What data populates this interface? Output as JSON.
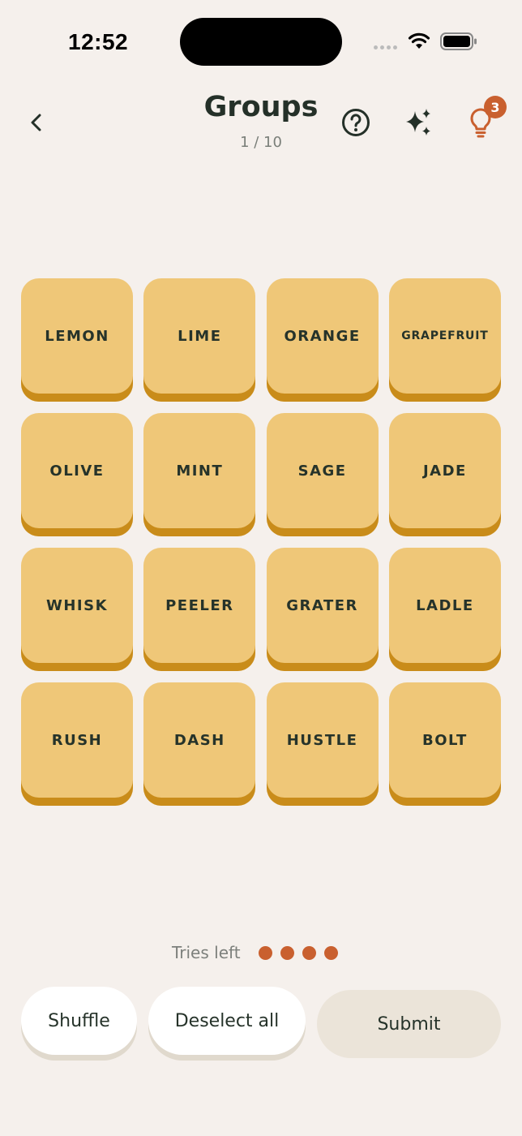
{
  "status_bar": {
    "time": "12:52"
  },
  "header": {
    "back_icon": "chevron-left-icon",
    "title": "Groups",
    "progress": "1 / 10",
    "help_icon": "question-circle-icon",
    "sparkle_icon": "sparkles-icon",
    "hint_icon": "lightbulb-icon",
    "hint_count": "3"
  },
  "tiles": [
    "LEMON",
    "LIME",
    "ORANGE",
    "GRAPEFRUIT",
    "OLIVE",
    "MINT",
    "SAGE",
    "JADE",
    "WHISK",
    "PEELER",
    "GRATER",
    "LADLE",
    "RUSH",
    "DASH",
    "HUSTLE",
    "BOLT"
  ],
  "tries": {
    "label": "Tries left",
    "remaining": 4
  },
  "actions": {
    "shuffle_label": "Shuffle",
    "deselect_label": "Deselect all",
    "submit_label": "Submit"
  },
  "colors": {
    "background": "#f5f0ec",
    "tile": "#efc778",
    "tile_shadow": "#c98c1a",
    "accent": "#c9602f",
    "text": "#26332a"
  }
}
